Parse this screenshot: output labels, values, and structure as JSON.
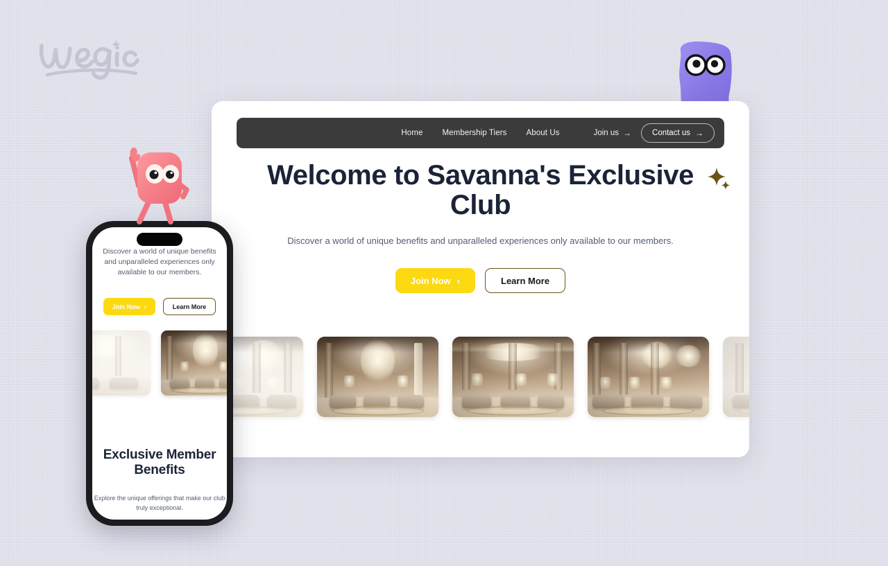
{
  "page": {
    "background_color": "#dfe0ea",
    "brand_logo_text": "wegic"
  },
  "browser_preview": {
    "navbar": {
      "background_color": "#3b3b3b",
      "links": [
        {
          "label": "Home"
        },
        {
          "label": "Membership Tiers"
        },
        {
          "label": "About Us"
        }
      ],
      "join_us_label": "Join us",
      "join_us_arrow": "→",
      "contact_label": "Contact us",
      "contact_arrow": "→"
    },
    "hero": {
      "title": "Welcome to Savanna's Exclusive Club",
      "title_color": "#1b2338",
      "sparkle_icon": "sparkle-icon",
      "sparkle_color": "#6b5316",
      "subtitle": "Discover a world of unique benefits and unparalleled experiences only available to our members.",
      "primary_button": {
        "label": "Join Now",
        "arrow": "›",
        "background_color": "#fcd911",
        "text_color": "#ffffff"
      },
      "secondary_button": {
        "label": "Learn More",
        "border_color": "#6b5316",
        "text_color": "#17181c"
      }
    },
    "carousel": {
      "slides": [
        {
          "alt": "Luxury ballroom with chandeliers",
          "state": "faded"
        },
        {
          "alt": "Grand lounge with central chandelier",
          "state": "active"
        },
        {
          "alt": "Modern luxury lounge with lit ceiling",
          "state": "active"
        },
        {
          "alt": "Elegant hotel lobby with armchairs",
          "state": "active"
        },
        {
          "alt": "Bright grand salon",
          "state": "faded"
        }
      ]
    }
  },
  "phone_preview": {
    "notch": "dynamic-island",
    "subtitle": "Discover a world of unique benefits and unparalleled experiences only available to our members.",
    "primary_button": {
      "label": "Join Now",
      "arrow": "›"
    },
    "secondary_button": {
      "label": "Learn More"
    },
    "carousel": {
      "slides": [
        {
          "alt": "Luxury lounge",
          "state": "faded"
        },
        {
          "alt": "Grand lounge with central chandelier",
          "state": "active"
        },
        {
          "alt": "Elegant hotel lobby",
          "state": "faded"
        }
      ]
    },
    "section_heading": "Exclusive Member Benefits",
    "section_subtitle": "Explore the unique offerings that make our club truly exceptional."
  },
  "mascots": [
    {
      "name": "purple-blob-mascot-with-glasses",
      "color": "#8b7ae8"
    },
    {
      "name": "pink-square-mascot-waving",
      "color": "#f4848c"
    }
  ]
}
